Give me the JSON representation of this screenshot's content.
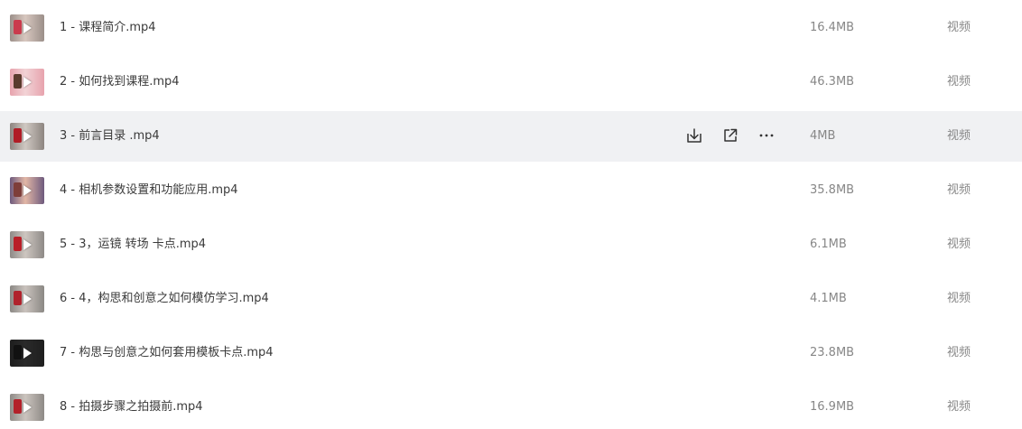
{
  "files": [
    {
      "name": "1 - 课程简介.mp4",
      "size": "16.4MB",
      "type": "视频",
      "thumb": [
        "#9b8f89",
        "#d7c7bf",
        "#ca3b4d"
      ]
    },
    {
      "name": "2 - 如何找到课程.mp4",
      "size": "46.3MB",
      "type": "视频",
      "thumb": [
        "#e7a3ad",
        "#f2d3d6",
        "#5a3b2d"
      ]
    },
    {
      "name": "3 - 前言目录 .mp4",
      "size": "4MB",
      "type": "视频",
      "thumb": [
        "#8d8580",
        "#cfc8c2",
        "#b01d26"
      ],
      "hovered": true
    },
    {
      "name": "4 - 相机参数设置和功能应用.mp4",
      "size": "35.8MB",
      "type": "视频",
      "thumb": [
        "#6e5a7d",
        "#e2b7a6",
        "#7e3e3a"
      ]
    },
    {
      "name": "5 - 3，运镜 转场 卡点.mp4",
      "size": "6.1MB",
      "type": "视频",
      "thumb": [
        "#8e8a87",
        "#cdc6c0",
        "#b91f28"
      ]
    },
    {
      "name": "6 - 4，构思和创意之如何模仿学习.mp4",
      "size": "4.1MB",
      "type": "视频",
      "thumb": [
        "#8b8884",
        "#c9c2bd",
        "#b0232c"
      ]
    },
    {
      "name": "7 - 构思与创意之如何套用模板卡点.mp4",
      "size": "23.8MB",
      "type": "视频",
      "thumb": [
        "#1e1e1e",
        "#2a2a2a",
        "#111111"
      ],
      "dark": true
    },
    {
      "name": "8 - 拍摄步骤之拍摄前.mp4",
      "size": "16.9MB",
      "type": "视频",
      "thumb": [
        "#8e8a86",
        "#cbc4be",
        "#b3212a"
      ]
    }
  ],
  "icons": {
    "download": "download-icon",
    "share": "share-icon",
    "more": "more-icon"
  }
}
